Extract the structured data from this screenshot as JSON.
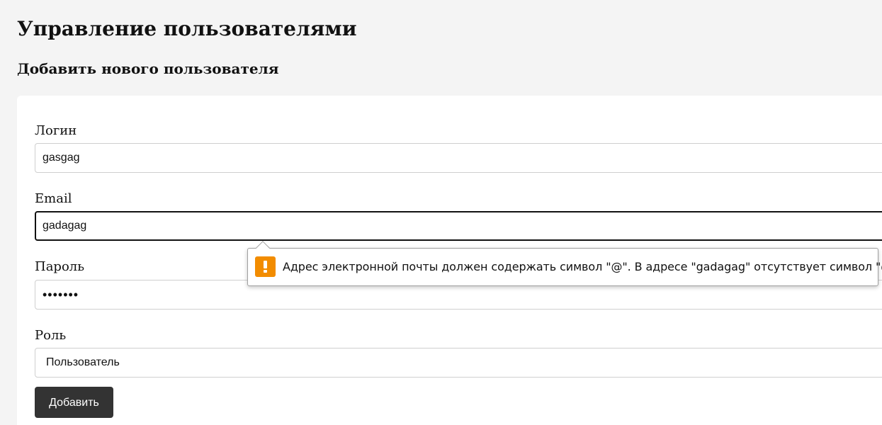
{
  "page": {
    "title": "Управление пользователями",
    "section_title": "Добавить нового пользователя"
  },
  "form": {
    "login": {
      "label": "Логин",
      "value": "gasgag"
    },
    "email": {
      "label": "Email",
      "value": "gadagag"
    },
    "password": {
      "label": "Пароль",
      "value": "•••••••"
    },
    "role": {
      "label": "Роль",
      "value": "Пользователь"
    },
    "submit_label": "Добавить"
  },
  "validation_tooltip": {
    "message": "Адрес электронной почты должен содержать символ \"@\". В адресе \"gadagag\" отсутствует символ \"@\".",
    "icon": "warning-icon"
  },
  "colors": {
    "background": "#f4f4f4",
    "card": "#ffffff",
    "button": "#333333",
    "warning": "#f28c00"
  }
}
